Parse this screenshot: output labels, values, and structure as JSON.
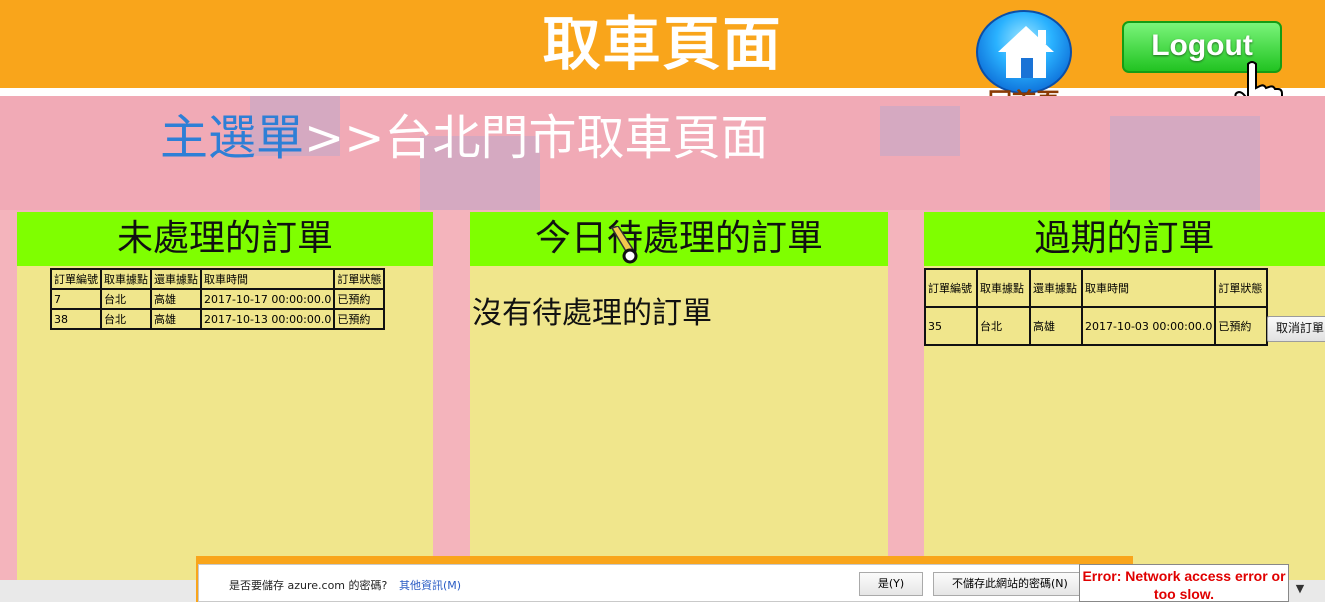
{
  "header": {
    "title": "取車頁面",
    "home_label": "回首頁",
    "logout_label": "Logout"
  },
  "breadcrumb": {
    "main": "主選單",
    "separator": ">>",
    "current": "台北門市取車頁面"
  },
  "panels": {
    "pending": {
      "title": "未處理的訂單",
      "columns": [
        "訂單編號",
        "取車據點",
        "還車據點",
        "取車時間",
        "訂單狀態"
      ],
      "rows": [
        [
          "7",
          "台北",
          "高雄",
          "2017-10-17 00:00:00.0",
          "已預約"
        ],
        [
          "38",
          "台北",
          "高雄",
          "2017-10-13 00:00:00.0",
          "已預約"
        ]
      ]
    },
    "today": {
      "title": "今日待處理的訂單",
      "empty_message": "沒有待處理的訂單"
    },
    "expired": {
      "title": "過期的訂單",
      "columns": [
        "訂單編號",
        "取車據點",
        "還車據點",
        "取車時間",
        "訂單狀態"
      ],
      "rows": [
        [
          "35",
          "台北",
          "高雄",
          "2017-10-03 00:00:00.0",
          "已預約"
        ]
      ],
      "cancel_label": "取消訂單"
    }
  },
  "password_bar": {
    "prompt": "是否要儲存 azure.com 的密碼?",
    "more_info": "其他資訊(M)",
    "yes_label": "是(Y)",
    "no_label": "不儲存此網站的密碼(N)"
  },
  "error": {
    "message": "Error: Network access error or too slow."
  },
  "colors": {
    "header": "#f9a51b",
    "panel_head": "#7fff00",
    "panel_body": "#f0e68c",
    "breadcrumb_link": "#2e7fd6",
    "error_text": "#e00000"
  }
}
